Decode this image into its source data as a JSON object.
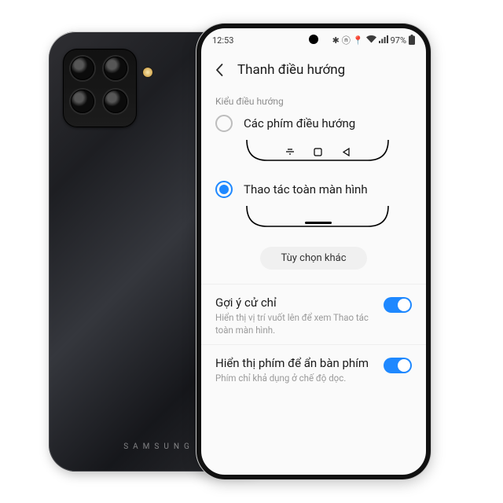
{
  "status": {
    "time": "12:53",
    "battery": "97%"
  },
  "header": {
    "title": "Thanh điều hướng"
  },
  "section_label": "Kiểu điều hướng",
  "options": {
    "buttons": "Các phím điều hướng",
    "gestures": "Thao tác toàn màn hình"
  },
  "more_button": "Tùy chọn khác",
  "rows": {
    "gesture_hint": {
      "title": "Gợi ý cử chỉ",
      "desc": "Hiển thị vị trí vuốt lên để xem Thao tác toàn màn hình."
    },
    "show_kb_button": {
      "title": "Hiển thị phím để ẩn bàn phím",
      "desc": "Phím chỉ khả dụng ở chế độ dọc."
    }
  },
  "back_brand": "SAMSUNG"
}
